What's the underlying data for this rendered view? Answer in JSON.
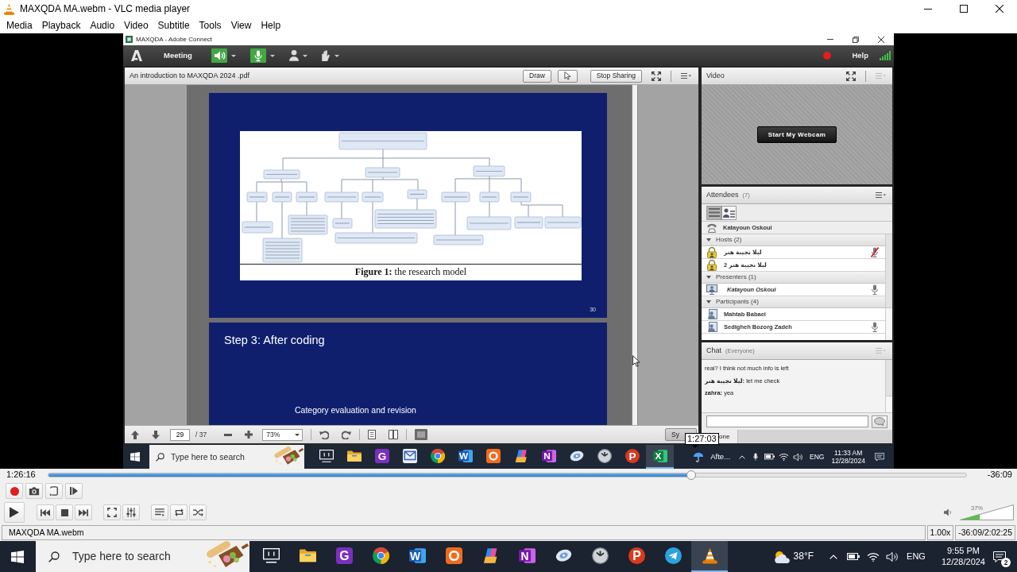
{
  "window": {
    "title": "MAXQDA MA.webm - VLC media player"
  },
  "menu": [
    "Media",
    "Playback",
    "Audio",
    "Video",
    "Subtitle",
    "Tools",
    "View",
    "Help"
  ],
  "video": {
    "window": {
      "title": "MAXQDA - Adobe Connect"
    },
    "toolbar": {
      "menu": "Meeting",
      "controls": [
        {
          "kind": "speaker",
          "on": true
        },
        {
          "kind": "microphone",
          "on": true
        },
        {
          "kind": "camera",
          "on": false
        },
        {
          "kind": "hand",
          "on": false
        }
      ],
      "recording": true,
      "help": "Help"
    },
    "share_pod": {
      "title": "An introduction to MAXQDA 2024 .pdf",
      "buttons": [
        {
          "kind": "text",
          "label": "Draw"
        },
        {
          "kind": "pointer"
        },
        {
          "kind": "text",
          "label": "Stop Sharing"
        }
      ],
      "slides": [
        {
          "kind": "figure",
          "caption": "**Figure 1:** the research model",
          "page": "30"
        },
        {
          "kind": "text",
          "title": "Step 3: After coding",
          "body": "Category evaluation and revision"
        }
      ],
      "footer": {
        "page": "29",
        "total": "/ 37",
        "zoom": "73%",
        "sync": "Sy"
      }
    },
    "video_pod": {
      "title": "Video",
      "button": "Start My Webcam"
    },
    "attendees": {
      "title": "Attendees",
      "count": "(7)",
      "views": [
        {
          "kind": "list",
          "selected": true
        },
        {
          "kind": "detail",
          "selected": false
        }
      ],
      "caller": "Katayoun Oskoui",
      "groups": [
        {
          "label": "Hosts (2)",
          "expanded": true,
          "members": [
            {
              "name": "لیلا نجیبة هنر",
              "kind": "host",
              "mic": true,
              "muted": true
            },
            {
              "name": "لیلا نجیبة هنر 2",
              "kind": "host",
              "mic": false,
              "muted": false
            }
          ]
        },
        {
          "label": "Presenters (1)",
          "expanded": true,
          "members": [
            {
              "name": "Katayoun Oskoui",
              "kind": "presenter",
              "mic": true,
              "muted": false
            }
          ]
        },
        {
          "label": "Participants (4)",
          "expanded": true,
          "members": [
            {
              "name": "Mahtab Babaei",
              "kind": "participant",
              "mic": false,
              "muted": false
            },
            {
              "name": "Sedigheh Bozorg Zadeh",
              "kind": "participant",
              "mic": true,
              "muted": false
            }
          ]
        }
      ]
    },
    "chat": {
      "title": "Chat",
      "scope": "(Everyone)",
      "messages": [
        "real? I think not much info is left",
        "**لیلا نجیبة هنر:** let me check",
        "**zahra:** yea"
      ],
      "tab": "one"
    },
    "taskbar": {
      "search": {
        "placeholder": "Type here to search"
      },
      "apps": [
        {
          "kind": "task-view",
          "active": false
        },
        {
          "kind": "folder",
          "active": false
        },
        {
          "kind": "pdf",
          "glyph": "G",
          "active": false
        },
        {
          "kind": "mail",
          "active": false
        },
        {
          "kind": "browser",
          "active": false
        },
        {
          "kind": "word-processor",
          "glyph": "W",
          "active": false
        },
        {
          "kind": "slides",
          "active": false
        },
        {
          "kind": "assistant",
          "active": false
        },
        {
          "kind": "notes",
          "glyph": "N",
          "active": false
        },
        {
          "kind": "disc",
          "active": false
        },
        {
          "kind": "clock",
          "active": false
        },
        {
          "kind": "p-app",
          "glyph": "P",
          "active": false
        },
        {
          "kind": "spreadsheet",
          "glyph": "X",
          "active": true
        }
      ],
      "weather": "Afte...",
      "language": "ENG",
      "time": "11:33 AM",
      "date": "12/28/2024"
    }
  },
  "player": {
    "elapsed": "1:26:16",
    "remaining": "-36:09",
    "level": 0.7,
    "tooltip": "1:27:03",
    "volume": {
      "reading": "37%",
      "level": 0.37
    },
    "status": {
      "file": "MAXQDA MA.webm",
      "speed": "1.00x",
      "time": "-36:09/2:02:25"
    }
  },
  "taskbar": {
    "search": {
      "placeholder": "Type here to search"
    },
    "apps": [
      {
        "kind": "task-view",
        "active": false
      },
      {
        "kind": "folder",
        "active": false
      },
      {
        "kind": "pdf",
        "glyph": "G",
        "active": false
      },
      {
        "kind": "browser",
        "active": false
      },
      {
        "kind": "word-processor",
        "glyph": "W",
        "active": false
      },
      {
        "kind": "slides",
        "active": false
      },
      {
        "kind": "assistant",
        "active": false
      },
      {
        "kind": "notes",
        "glyph": "N",
        "active": false
      },
      {
        "kind": "disc",
        "active": false
      },
      {
        "kind": "clock",
        "active": false
      },
      {
        "kind": "p-app",
        "glyph": "P",
        "active": false
      },
      {
        "kind": "messenger",
        "active": false
      },
      {
        "kind": "media-player",
        "active": true
      }
    ],
    "weather": "38°F",
    "language": "ENG",
    "time": "9:55 PM",
    "date": "12/28/2024",
    "notifications": "2"
  }
}
